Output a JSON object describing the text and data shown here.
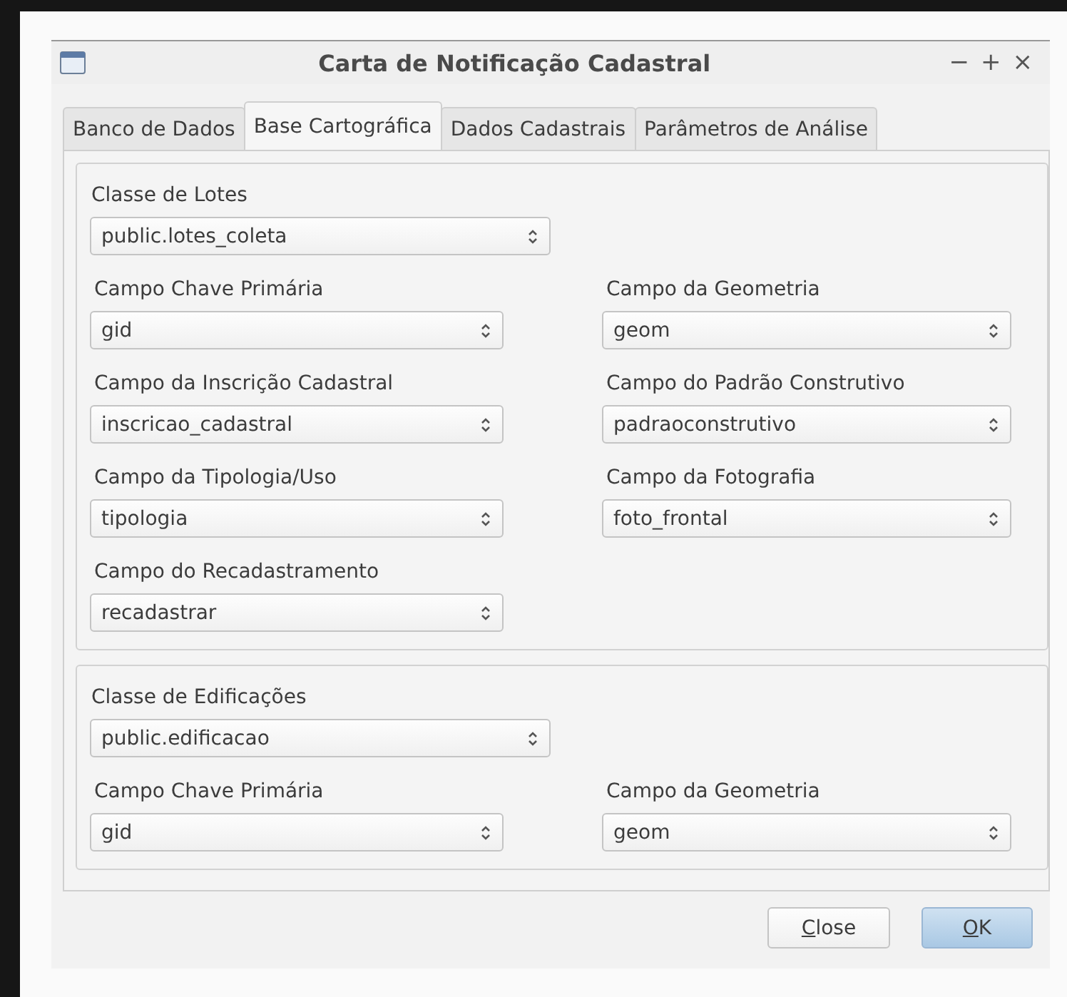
{
  "window": {
    "title": "Carta de Notificação Cadastral",
    "controls": [
      "−",
      "+",
      "×"
    ]
  },
  "tabs": [
    {
      "label": "Banco de Dados",
      "selected": false
    },
    {
      "label": "Base Cartográfica",
      "selected": true
    },
    {
      "label": "Dados Cadastrais",
      "selected": false
    },
    {
      "label": "Parâmetros de Análise",
      "selected": false
    }
  ],
  "groups": [
    {
      "class_label": "Classe de Lotes",
      "class_value": "public.lotes_coleta",
      "fields": [
        {
          "label": "Campo Chave Primária",
          "value": "gid"
        },
        {
          "label": "Campo da Geometria",
          "value": "geom"
        },
        {
          "label": "Campo da Inscrição Cadastral",
          "value": "inscricao_cadastral"
        },
        {
          "label": "Campo do Padrão Construtivo",
          "value": "padraoconstrutivo"
        },
        {
          "label": "Campo da Tipologia/Uso",
          "value": "tipologia"
        },
        {
          "label": "Campo da Fotografia",
          "value": "foto_frontal"
        },
        {
          "label": "Campo do Recadastramento",
          "value": "recadastrar"
        }
      ]
    },
    {
      "class_label": "Classe de Edificações",
      "class_value": "public.edificacao",
      "fields": [
        {
          "label": "Campo Chave Primária",
          "value": "gid"
        },
        {
          "label": "Campo da Geometria",
          "value": "geom"
        }
      ]
    }
  ],
  "buttons": [
    {
      "label": "Close",
      "default": false
    },
    {
      "label": "OK",
      "default": true
    }
  ]
}
